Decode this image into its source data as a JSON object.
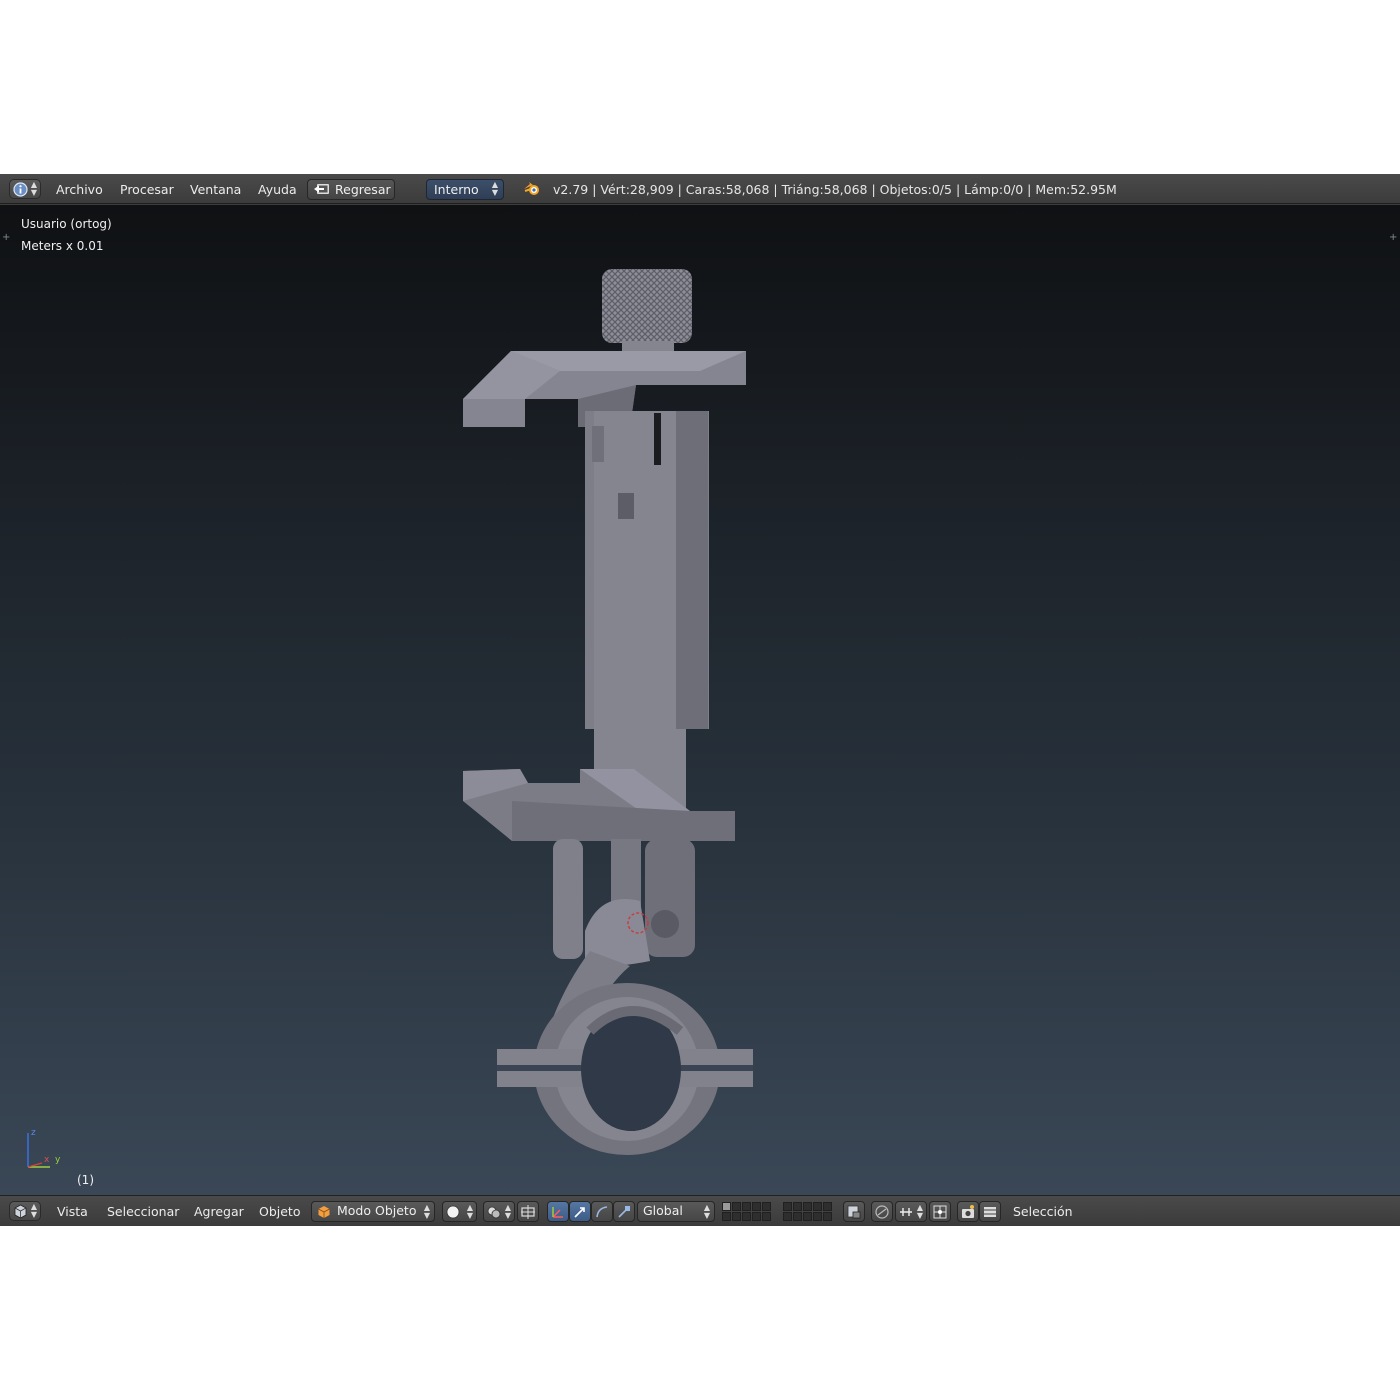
{
  "info_header": {
    "menus": [
      "Archivo",
      "Procesar",
      "Ventana",
      "Ayuda"
    ],
    "back_button": "Regresar",
    "render_engine": "Interno",
    "stats": "v2.79 | Vért:28,909 | Caras:58,068 | Triáng:58,068 | Objetos:0/5 | Lámp:0/0 | Mem:52.95M"
  },
  "viewport": {
    "view_name": "Usuario (ortog)",
    "units": "Meters x 0.01",
    "frame": "(1)",
    "axis_labels": {
      "z": "z",
      "x": "x",
      "y": "y"
    }
  },
  "view3d_header": {
    "menus": [
      "Vista",
      "Seleccionar",
      "Agregar",
      "Objeto"
    ],
    "mode": "Modo Objeto",
    "transform_orientation": "Global",
    "status": "Selección"
  },
  "colors": {
    "header_bg": "#444444",
    "viewport_top": "#0f1113",
    "viewport_bottom": "#3a4756",
    "active_blue": "#4a6a96",
    "model_gray": "#7b7b87"
  },
  "icons": [
    "info-editor-icon",
    "back-icon",
    "blender-logo-icon",
    "view3d-editor-icon",
    "object-mode-cube-icon",
    "viewport-shading-icon",
    "pivot-icon",
    "manipulator-icon",
    "snap-icon",
    "render-icon"
  ]
}
